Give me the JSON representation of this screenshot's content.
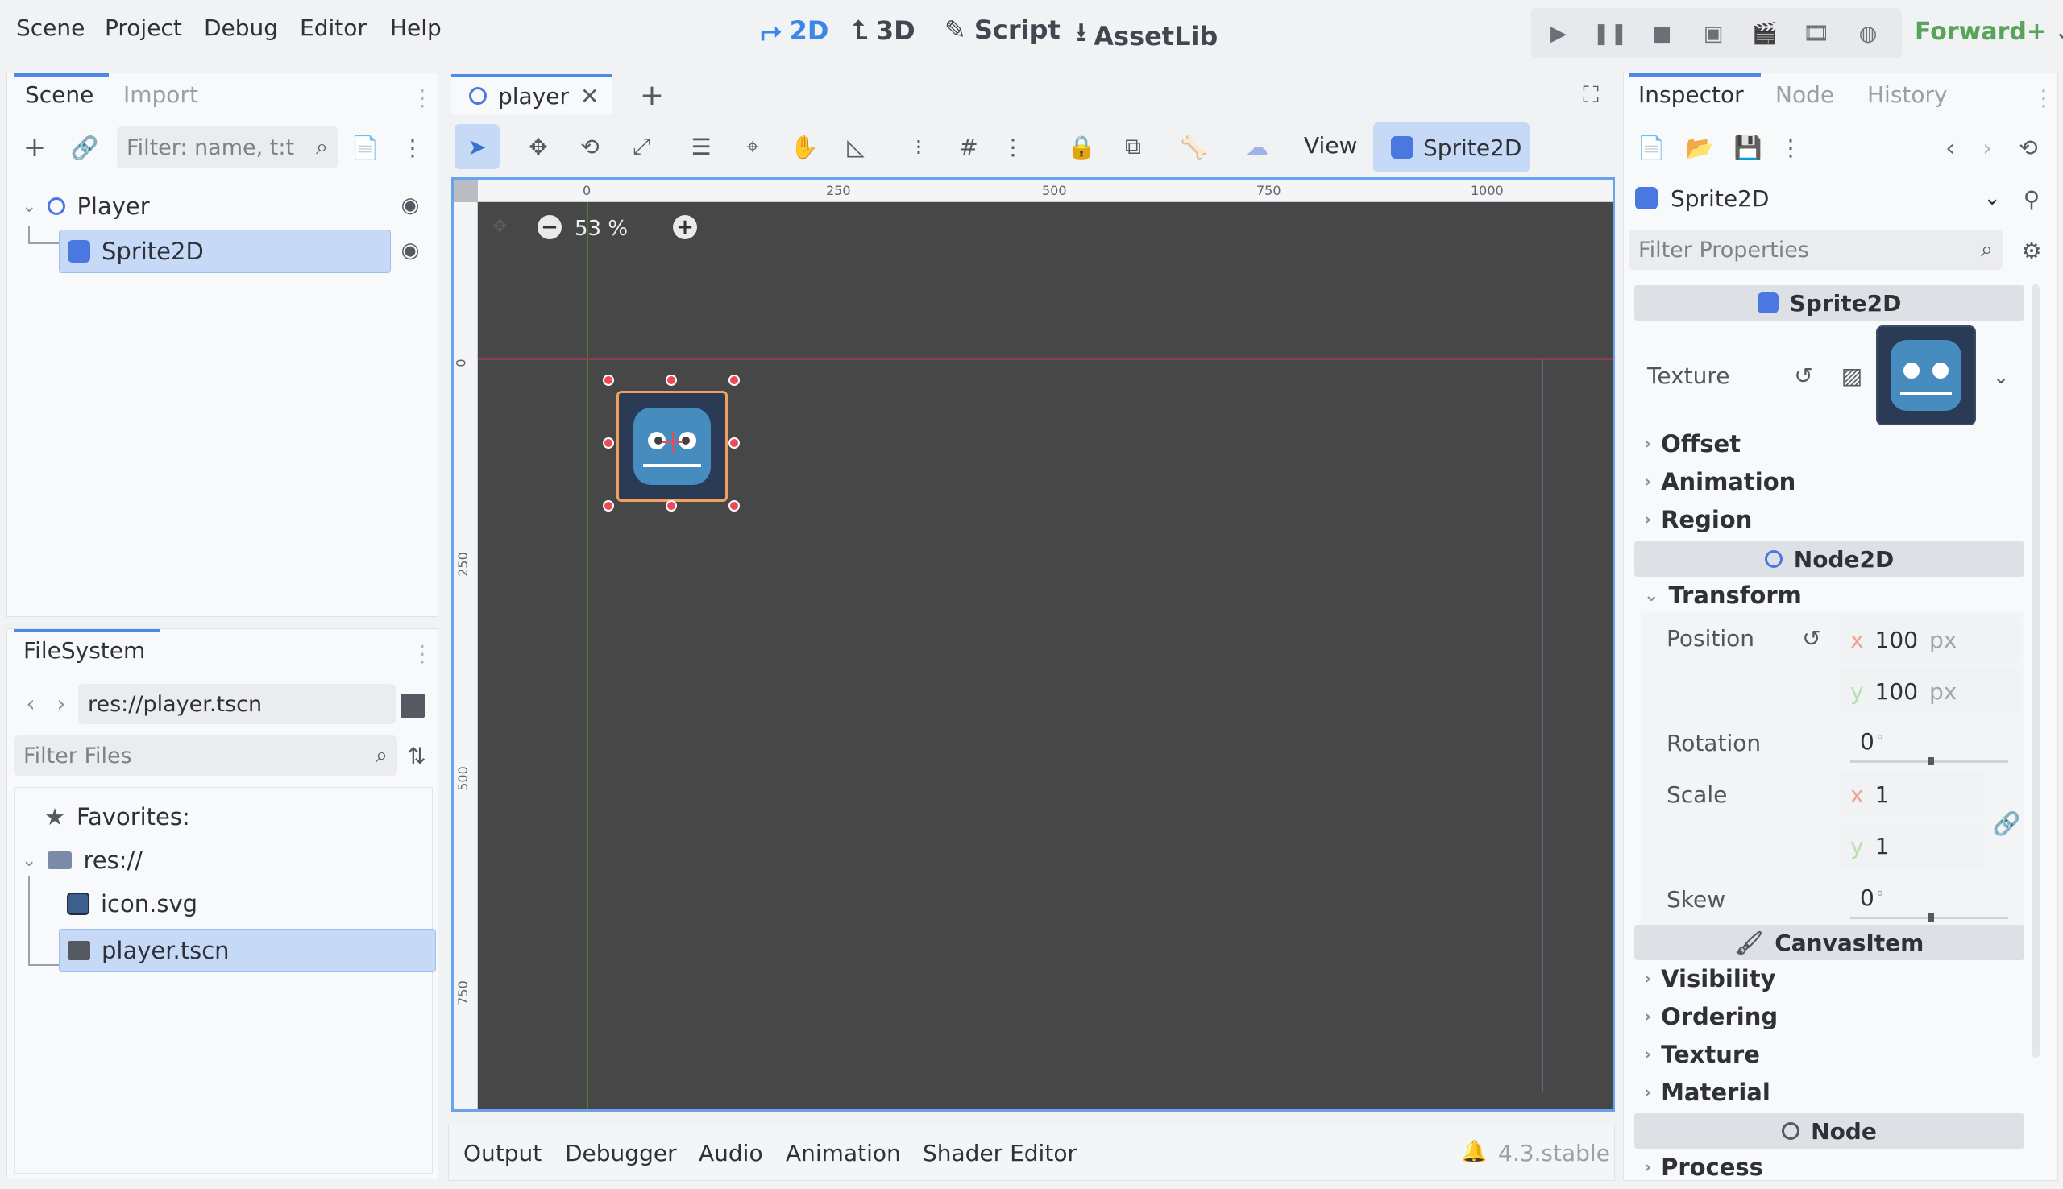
{
  "menubar": {
    "menus": [
      "Scene",
      "Project",
      "Debug",
      "Editor",
      "Help"
    ],
    "workspaces": [
      "2D",
      "3D",
      "Script",
      "AssetLib"
    ],
    "active_workspace": "2D",
    "renderer": "Forward+"
  },
  "scene_dock": {
    "tabs": [
      "Scene",
      "Import"
    ],
    "filter_placeholder": "Filter: name, t:t",
    "tree": [
      {
        "label": "Player",
        "icon": "node2d-ring-icon"
      },
      {
        "label": "Sprite2D",
        "icon": "sprite2d-icon",
        "selected": true
      }
    ]
  },
  "filesystem_dock": {
    "title": "FileSystem",
    "path": "res://player.tscn",
    "filter_placeholder": "Filter Files",
    "items": [
      {
        "label": "Favorites:",
        "icon": "star-icon"
      },
      {
        "label": "res://",
        "icon": "folder-icon"
      },
      {
        "label": "icon.svg",
        "icon": "godot-icon"
      },
      {
        "label": "player.tscn",
        "icon": "clapper-icon",
        "selected": true
      }
    ]
  },
  "editor": {
    "scene_tab": "player",
    "view_menu": "View",
    "selected_node_button": "Sprite2D",
    "zoom": "53 %",
    "ruler_top": [
      "0",
      "250",
      "500",
      "750",
      "1000"
    ],
    "ruler_left": [
      "0",
      "250",
      "500",
      "750"
    ]
  },
  "inspector": {
    "tabs": [
      "Inspector",
      "Node",
      "History"
    ],
    "object": "Sprite2D",
    "filter_placeholder": "Filter Properties",
    "sections": {
      "sprite2d": "Sprite2D",
      "node2d": "Node2D",
      "canvasitem": "CanvasItem",
      "node": "Node"
    },
    "texture_label": "Texture",
    "sprite_categories": [
      "Offset",
      "Animation",
      "Region"
    ],
    "transform": {
      "label": "Transform",
      "position_label": "Position",
      "position_x": "100",
      "position_y": "100",
      "unit": "px",
      "rotation_label": "Rotation",
      "rotation": "0",
      "scale_label": "Scale",
      "scale_x": "1",
      "scale_y": "1",
      "skew_label": "Skew",
      "skew": "0",
      "degree": "°",
      "x": "x",
      "y": "y"
    },
    "canvas_categories": [
      "Visibility",
      "Ordering",
      "Texture",
      "Material"
    ],
    "node_categories": [
      "Process"
    ]
  },
  "bottom_panel": {
    "tabs": [
      "Output",
      "Debugger",
      "Audio",
      "Animation",
      "Shader Editor"
    ],
    "version": "4.3.stable"
  },
  "colors": {
    "accent": "#4a8be8",
    "viewport_bg": "#474747",
    "selection": "#c6daf8",
    "handle": "#ec4a56"
  }
}
